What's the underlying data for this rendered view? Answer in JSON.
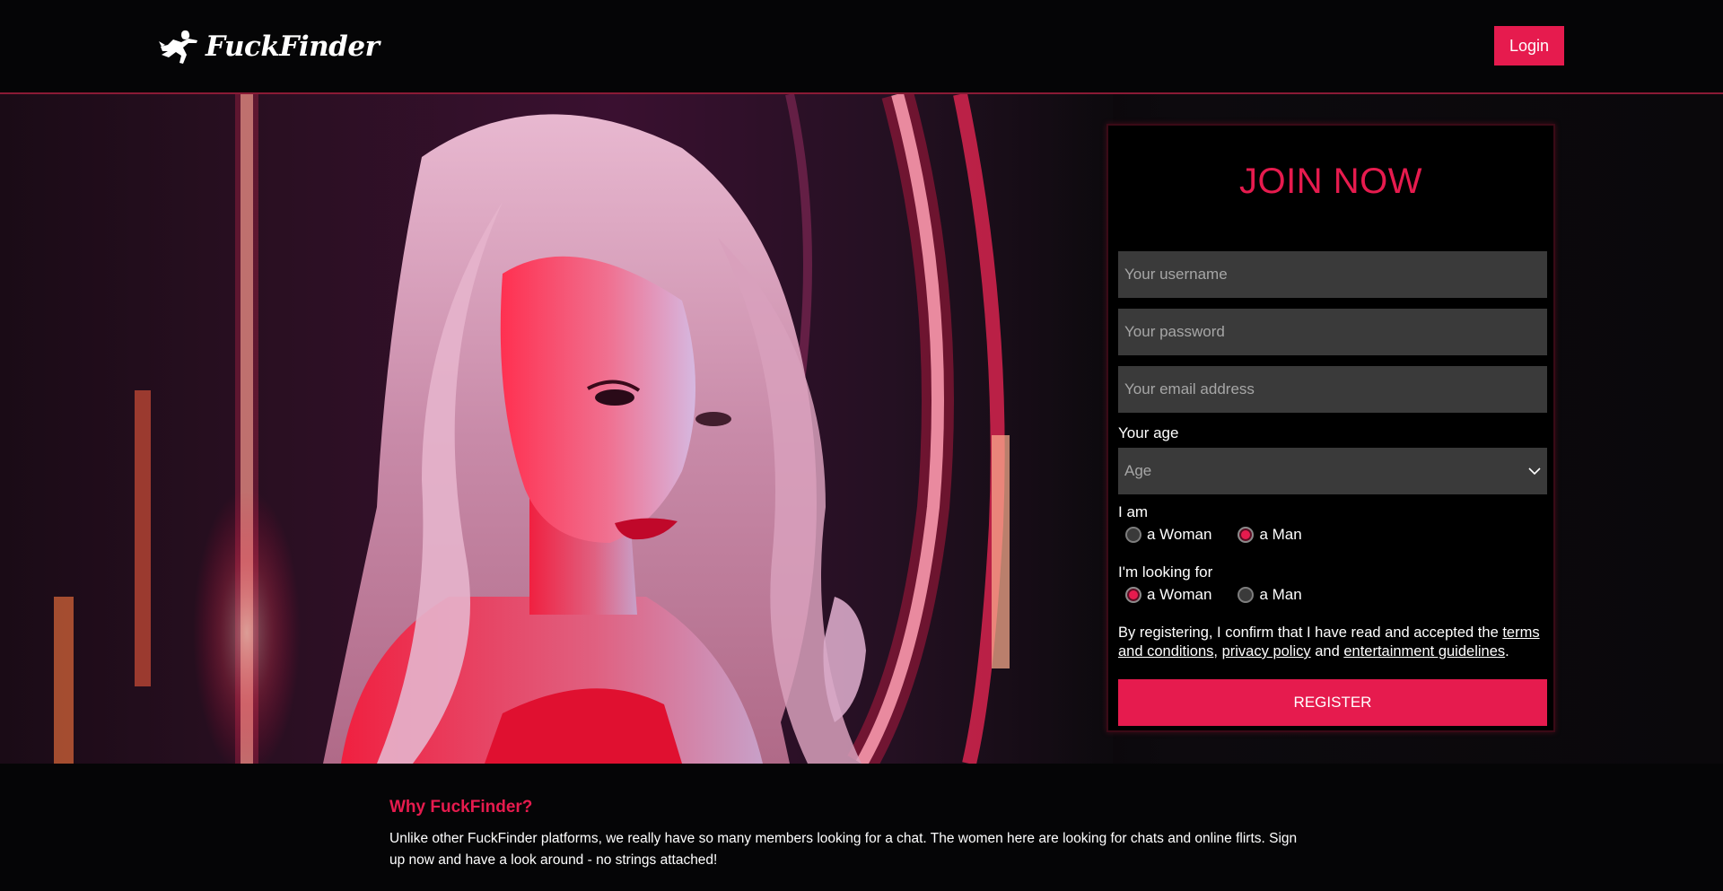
{
  "header": {
    "logo_text": "FuckFinder",
    "login_label": "Login"
  },
  "form": {
    "title": "JOIN NOW",
    "username_placeholder": "Your username",
    "password_placeholder": "Your password",
    "email_placeholder": "Your email address",
    "age_label": "Your age",
    "age_selected": "Age",
    "i_am_label": "I am",
    "i_am_options": [
      "a Woman",
      "a Man"
    ],
    "i_am_selected": "a Man",
    "looking_for_label": "I'm looking for",
    "looking_for_options": [
      "a Woman",
      "a Man"
    ],
    "looking_for_selected": "a Woman",
    "terms_prefix": "By registering, I confirm that I have read and accepted the ",
    "terms_link": "terms and conditions",
    "terms_sep1": ", ",
    "privacy_link": "privacy policy",
    "terms_sep2": " and ",
    "guidelines_link": "entertainment guidelines",
    "terms_suffix": ".",
    "register_label": "REGISTER"
  },
  "about": {
    "title": "Why FuckFinder?",
    "text": "Unlike other FuckFinder platforms, we really have so many members looking for a chat. The women here are looking for chats and online flirts. Sign up now and have a look around - no strings attached!"
  },
  "colors": {
    "accent": "#e61b4e",
    "background": "#050506",
    "input_bg": "#3a3a3a"
  },
  "icons": {
    "logo_mark": "running-figure-icon",
    "select_arrow": "chevron-down-icon"
  }
}
